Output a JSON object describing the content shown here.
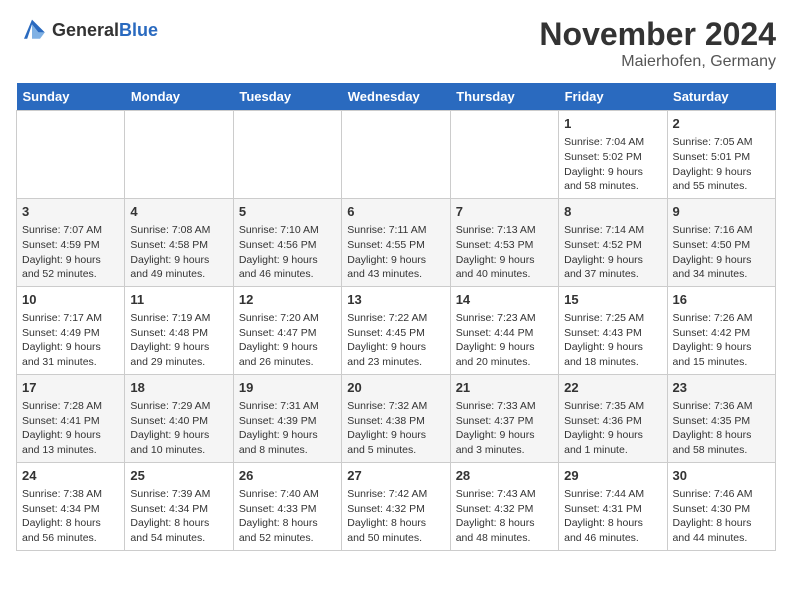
{
  "logo": {
    "general": "General",
    "blue": "Blue"
  },
  "title": "November 2024",
  "subtitle": "Maierhofen, Germany",
  "days_of_week": [
    "Sunday",
    "Monday",
    "Tuesday",
    "Wednesday",
    "Thursday",
    "Friday",
    "Saturday"
  ],
  "weeks": [
    [
      {
        "day": "",
        "info": ""
      },
      {
        "day": "",
        "info": ""
      },
      {
        "day": "",
        "info": ""
      },
      {
        "day": "",
        "info": ""
      },
      {
        "day": "",
        "info": ""
      },
      {
        "day": "1",
        "info": "Sunrise: 7:04 AM\nSunset: 5:02 PM\nDaylight: 9 hours and 58 minutes."
      },
      {
        "day": "2",
        "info": "Sunrise: 7:05 AM\nSunset: 5:01 PM\nDaylight: 9 hours and 55 minutes."
      }
    ],
    [
      {
        "day": "3",
        "info": "Sunrise: 7:07 AM\nSunset: 4:59 PM\nDaylight: 9 hours and 52 minutes."
      },
      {
        "day": "4",
        "info": "Sunrise: 7:08 AM\nSunset: 4:58 PM\nDaylight: 9 hours and 49 minutes."
      },
      {
        "day": "5",
        "info": "Sunrise: 7:10 AM\nSunset: 4:56 PM\nDaylight: 9 hours and 46 minutes."
      },
      {
        "day": "6",
        "info": "Sunrise: 7:11 AM\nSunset: 4:55 PM\nDaylight: 9 hours and 43 minutes."
      },
      {
        "day": "7",
        "info": "Sunrise: 7:13 AM\nSunset: 4:53 PM\nDaylight: 9 hours and 40 minutes."
      },
      {
        "day": "8",
        "info": "Sunrise: 7:14 AM\nSunset: 4:52 PM\nDaylight: 9 hours and 37 minutes."
      },
      {
        "day": "9",
        "info": "Sunrise: 7:16 AM\nSunset: 4:50 PM\nDaylight: 9 hours and 34 minutes."
      }
    ],
    [
      {
        "day": "10",
        "info": "Sunrise: 7:17 AM\nSunset: 4:49 PM\nDaylight: 9 hours and 31 minutes."
      },
      {
        "day": "11",
        "info": "Sunrise: 7:19 AM\nSunset: 4:48 PM\nDaylight: 9 hours and 29 minutes."
      },
      {
        "day": "12",
        "info": "Sunrise: 7:20 AM\nSunset: 4:47 PM\nDaylight: 9 hours and 26 minutes."
      },
      {
        "day": "13",
        "info": "Sunrise: 7:22 AM\nSunset: 4:45 PM\nDaylight: 9 hours and 23 minutes."
      },
      {
        "day": "14",
        "info": "Sunrise: 7:23 AM\nSunset: 4:44 PM\nDaylight: 9 hours and 20 minutes."
      },
      {
        "day": "15",
        "info": "Sunrise: 7:25 AM\nSunset: 4:43 PM\nDaylight: 9 hours and 18 minutes."
      },
      {
        "day": "16",
        "info": "Sunrise: 7:26 AM\nSunset: 4:42 PM\nDaylight: 9 hours and 15 minutes."
      }
    ],
    [
      {
        "day": "17",
        "info": "Sunrise: 7:28 AM\nSunset: 4:41 PM\nDaylight: 9 hours and 13 minutes."
      },
      {
        "day": "18",
        "info": "Sunrise: 7:29 AM\nSunset: 4:40 PM\nDaylight: 9 hours and 10 minutes."
      },
      {
        "day": "19",
        "info": "Sunrise: 7:31 AM\nSunset: 4:39 PM\nDaylight: 9 hours and 8 minutes."
      },
      {
        "day": "20",
        "info": "Sunrise: 7:32 AM\nSunset: 4:38 PM\nDaylight: 9 hours and 5 minutes."
      },
      {
        "day": "21",
        "info": "Sunrise: 7:33 AM\nSunset: 4:37 PM\nDaylight: 9 hours and 3 minutes."
      },
      {
        "day": "22",
        "info": "Sunrise: 7:35 AM\nSunset: 4:36 PM\nDaylight: 9 hours and 1 minute."
      },
      {
        "day": "23",
        "info": "Sunrise: 7:36 AM\nSunset: 4:35 PM\nDaylight: 8 hours and 58 minutes."
      }
    ],
    [
      {
        "day": "24",
        "info": "Sunrise: 7:38 AM\nSunset: 4:34 PM\nDaylight: 8 hours and 56 minutes."
      },
      {
        "day": "25",
        "info": "Sunrise: 7:39 AM\nSunset: 4:34 PM\nDaylight: 8 hours and 54 minutes."
      },
      {
        "day": "26",
        "info": "Sunrise: 7:40 AM\nSunset: 4:33 PM\nDaylight: 8 hours and 52 minutes."
      },
      {
        "day": "27",
        "info": "Sunrise: 7:42 AM\nSunset: 4:32 PM\nDaylight: 8 hours and 50 minutes."
      },
      {
        "day": "28",
        "info": "Sunrise: 7:43 AM\nSunset: 4:32 PM\nDaylight: 8 hours and 48 minutes."
      },
      {
        "day": "29",
        "info": "Sunrise: 7:44 AM\nSunset: 4:31 PM\nDaylight: 8 hours and 46 minutes."
      },
      {
        "day": "30",
        "info": "Sunrise: 7:46 AM\nSunset: 4:30 PM\nDaylight: 8 hours and 44 minutes."
      }
    ]
  ]
}
